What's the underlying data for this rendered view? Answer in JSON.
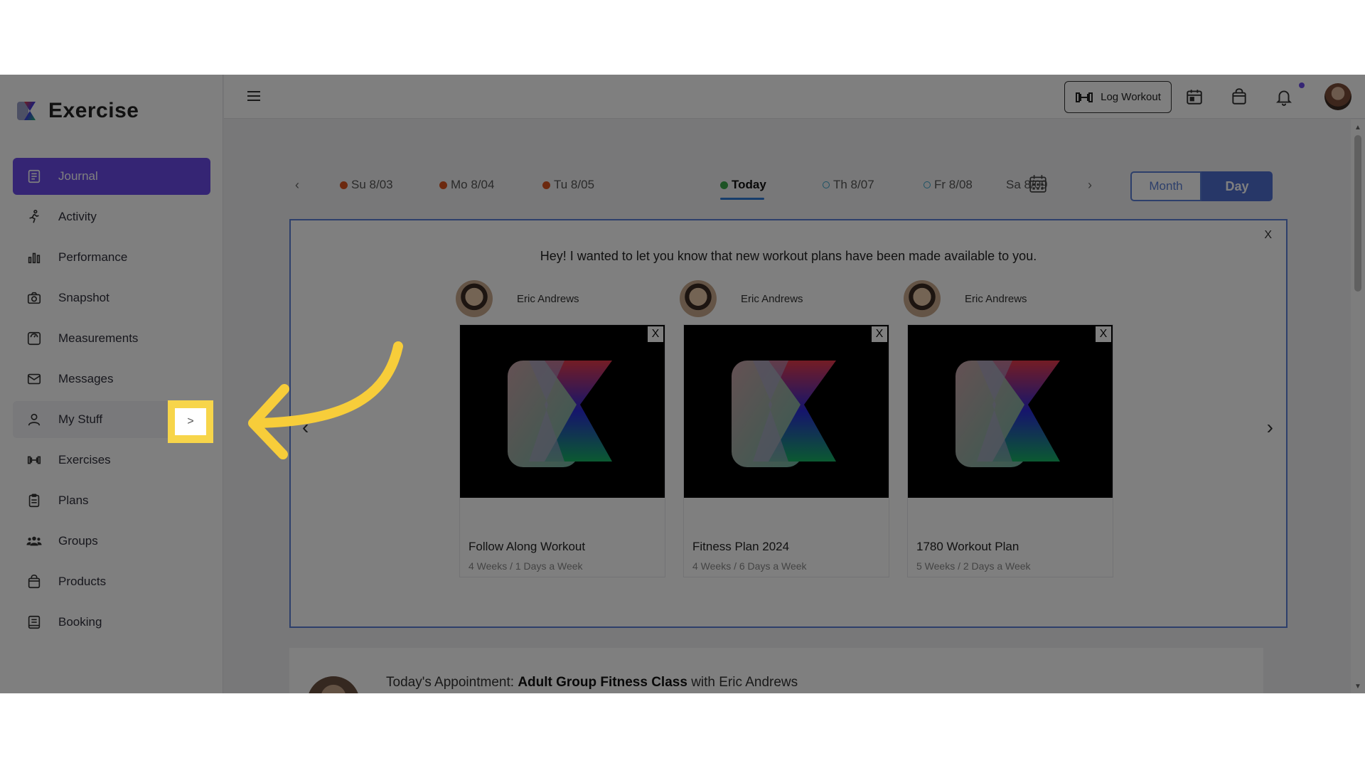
{
  "brand": {
    "name": "Exercise"
  },
  "sidebar": {
    "items": [
      {
        "label": "Journal",
        "icon": "journal-icon"
      },
      {
        "label": "Activity",
        "icon": "activity-icon"
      },
      {
        "label": "Performance",
        "icon": "performance-icon"
      },
      {
        "label": "Snapshot",
        "icon": "camera-icon"
      },
      {
        "label": "Measurements",
        "icon": "scale-icon"
      },
      {
        "label": "Messages",
        "icon": "mail-icon"
      },
      {
        "label": "My Stuff",
        "icon": "user-icon"
      },
      {
        "label": "Exercises",
        "icon": "dumbbell-icon"
      },
      {
        "label": "Plans",
        "icon": "clipboard-icon"
      },
      {
        "label": "Groups",
        "icon": "group-icon"
      },
      {
        "label": "Products",
        "icon": "bag-icon"
      },
      {
        "label": "Booking",
        "icon": "book-icon"
      }
    ],
    "expand_glyph": ">"
  },
  "topbar": {
    "log_workout": "Log Workout"
  },
  "dates": {
    "prev": "‹",
    "next": "›",
    "tabs": [
      {
        "label": "Su 8/03",
        "status": "#d9531e"
      },
      {
        "label": "Mo 8/04",
        "status": "#d9531e"
      },
      {
        "label": "Tu 8/05",
        "status": "#d9531e"
      },
      {
        "label": "Today",
        "status": "#3aa64a"
      },
      {
        "label": "Th 8/07",
        "status": "ring-#36a3c9"
      },
      {
        "label": "Fr 8/08",
        "status": "ring-#36a3c9"
      },
      {
        "label": "Sa 8/09",
        "status": "none"
      }
    ],
    "view_month": "Month",
    "view_day": "Day"
  },
  "panel": {
    "close": "X",
    "message": "Hey! I wanted to let you know that new workout plans have been made available to you.",
    "prev": "‹",
    "next": "›",
    "cards": [
      {
        "coach": "Eric Andrews",
        "title": "Follow Along Workout",
        "sub": "4 Weeks / 1 Days a Week",
        "close": "X"
      },
      {
        "coach": "Eric Andrews",
        "title": "Fitness Plan 2024",
        "sub": "4 Weeks / 6 Days a Week",
        "close": "X"
      },
      {
        "coach": "Eric Andrews",
        "title": "1780 Workout Plan",
        "sub": "5 Weeks / 2 Days a Week",
        "close": "X"
      }
    ]
  },
  "appointment": {
    "prefix": "Today's Appointment:",
    "name": "Adult Group Fitness Class",
    "suffix": "with Eric Andrews"
  },
  "colors": {
    "accent": "#6a4be8",
    "blue": "#4e6fd1",
    "highlight": "#f7d54a"
  }
}
